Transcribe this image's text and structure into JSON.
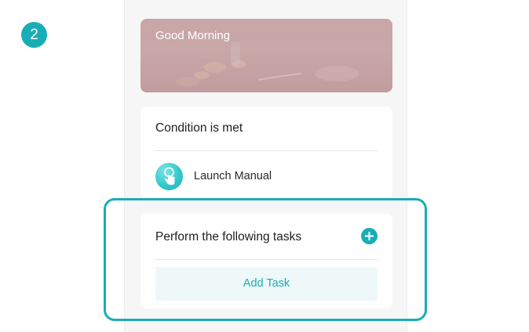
{
  "step": {
    "number": "2"
  },
  "banner": {
    "title": "Good Morning"
  },
  "condition": {
    "heading": "Condition is met",
    "item": {
      "label": "Launch Manual",
      "icon": "tap-hand-icon"
    }
  },
  "tasks": {
    "heading": "Perform the following tasks",
    "add_icon": "plus-circle-icon",
    "add_label": "Add Task"
  },
  "colors": {
    "accent": "#19aeb6",
    "background": "#f6f6f6",
    "card": "#ffffff",
    "add_task_bg": "#eef8f9",
    "banner": "#c8a7a7"
  }
}
